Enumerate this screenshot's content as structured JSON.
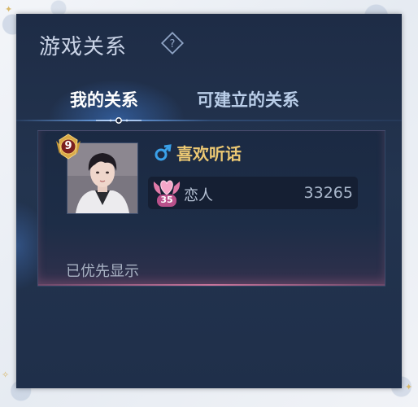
{
  "header": {
    "title": "游戏关系",
    "help_icon": "question-diamond-icon"
  },
  "tabs": [
    {
      "label": "我的关系",
      "active": true
    },
    {
      "label": "可建立的关系",
      "active": false
    }
  ],
  "relation_card": {
    "rank_level": "9",
    "player_name": "喜欢听话",
    "gender_icon": "male-icon",
    "relation": {
      "level": "35",
      "label": "恋人",
      "value": "33265",
      "icon": "heart-wings-icon"
    },
    "priority_text": "已优先显示"
  },
  "colors": {
    "panel_bg": "#22314c",
    "name_gold": "#ecc873",
    "relation_pink": "#e88ab4",
    "gender_blue": "#3aa0e8"
  }
}
